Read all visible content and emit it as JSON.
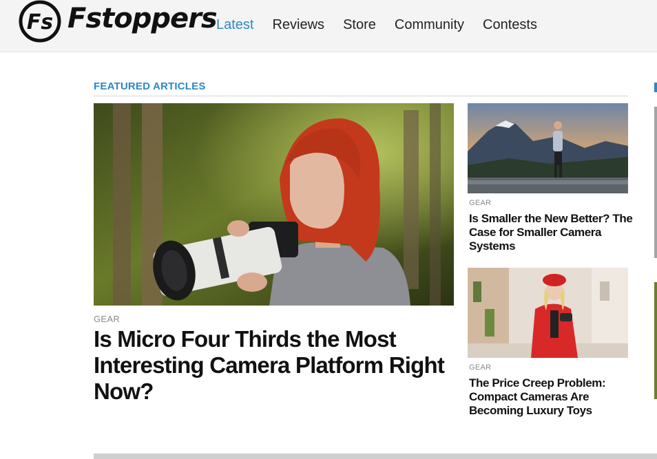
{
  "site": {
    "logo_text": "Fstoppers",
    "logo_mark": "Fs"
  },
  "nav": {
    "items": [
      {
        "label": "Latest",
        "active": true
      },
      {
        "label": "Reviews",
        "active": false
      },
      {
        "label": "Store",
        "active": false
      },
      {
        "label": "Community",
        "active": false
      },
      {
        "label": "Contests",
        "active": false
      }
    ]
  },
  "featured": {
    "section_title": "FEATURED ARTICLES",
    "main": {
      "category": "GEAR",
      "title": "Is Micro Four Thirds the Most Interesting Camera Platform Right Now?"
    },
    "side": [
      {
        "category": "GEAR",
        "title": "Is Smaller the New Better? The Case for Smaller Camera Systems"
      },
      {
        "category": "GEAR",
        "title": "The Price Creep Problem: Compact Cameras Are Becoming Luxury Toys"
      }
    ]
  },
  "colors": {
    "accent": "#2b87c9",
    "header_bg": "#f4f4f4",
    "category_gray": "#8a8a8a"
  }
}
